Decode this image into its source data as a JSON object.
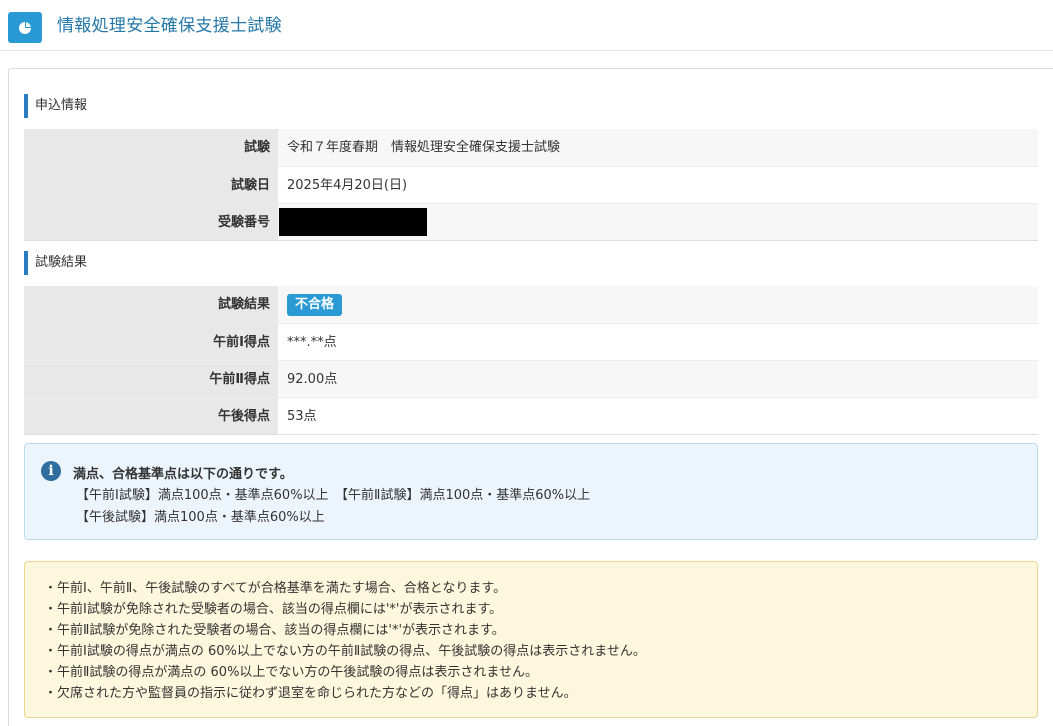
{
  "header": {
    "title": "情報処理安全確保支援士試験",
    "icon": "pie-chart-icon",
    "icon_bg": "#2a9ad4"
  },
  "application_info": {
    "heading": "申込情報",
    "rows": [
      {
        "label": "試験",
        "value": "令和７年度春期　情報処理安全確保支援士試験"
      },
      {
        "label": "試験日",
        "value": "2025年4月20日(日)"
      },
      {
        "label": "受験番号",
        "value": ""
      }
    ]
  },
  "exam_result": {
    "heading": "試験結果",
    "result_label": "試験結果",
    "result_badge": "不合格",
    "badge_color": "#2a9ad4",
    "rows": [
      {
        "label": "午前Ⅰ得点",
        "value": "***.**点"
      },
      {
        "label": "午前Ⅱ得点",
        "value": "92.00点"
      },
      {
        "label": "午後得点",
        "value": "53点"
      }
    ]
  },
  "info_alert": {
    "icon": "info-circle-icon",
    "title": "満点、合格基準点は以下の通りです。",
    "lines": [
      "【午前Ⅰ試験】満点100点・基準点60%以上　【午前Ⅱ試験】満点100点・基準点60%以上",
      "【午後試験】満点100点・基準点60%以上"
    ]
  },
  "notes": [
    "・午前Ⅰ、午前Ⅱ、午後試験のすべてが合格基準を満たす場合、合格となります。",
    "・午前Ⅰ試験が免除された受験者の場合、該当の得点欄には'*'が表示されます。",
    "・午前Ⅱ試験が免除された受験者の場合、該当の得点欄には'*'が表示されます。",
    "・午前Ⅰ試験の得点が満点の 60%以上でない方の午前Ⅱ試験の得点、午後試験の得点は表示されません。",
    "・午前Ⅱ試験の得点が満点の 60%以上でない方の午後試験の得点は表示されません。",
    "・欠席された方や監督員の指示に従わず退室を命じられた方などの「得点」はありません。"
  ]
}
